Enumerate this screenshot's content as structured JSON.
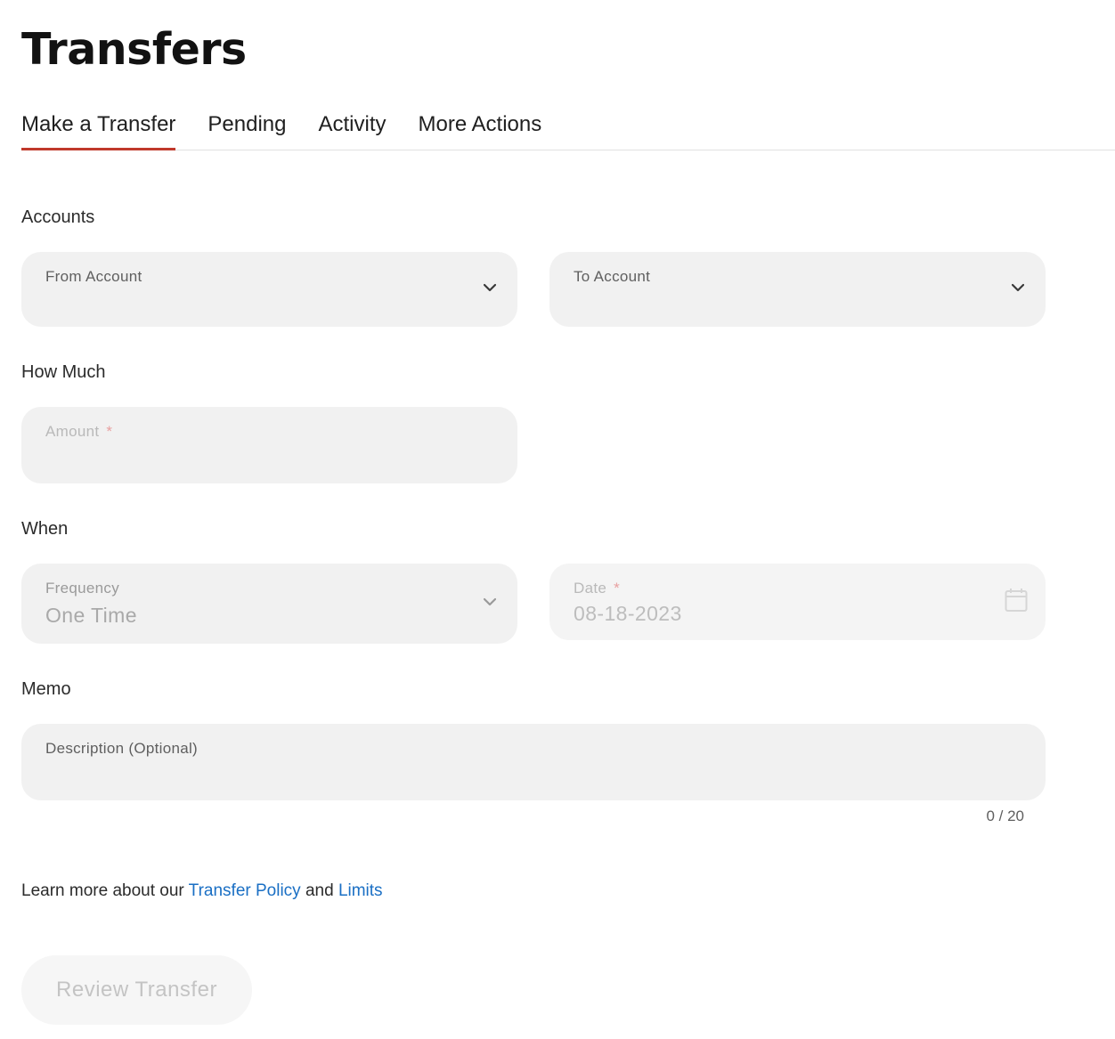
{
  "page": {
    "title": "Transfers"
  },
  "tabs": [
    {
      "label": "Make a Transfer",
      "active": true
    },
    {
      "label": "Pending",
      "active": false
    },
    {
      "label": "Activity",
      "active": false
    },
    {
      "label": "More Actions",
      "active": false
    }
  ],
  "sections": {
    "accounts": "Accounts",
    "how_much": "How Much",
    "when": "When",
    "memo": "Memo"
  },
  "fields": {
    "from_account": {
      "label": "From Account",
      "value": ""
    },
    "to_account": {
      "label": "To Account",
      "value": ""
    },
    "amount": {
      "label": "Amount",
      "required_mark": "*",
      "value": ""
    },
    "frequency": {
      "label": "Frequency",
      "value": "One Time"
    },
    "date": {
      "label": "Date",
      "required_mark": "*",
      "value": "08-18-2023"
    },
    "description": {
      "label": "Description (Optional)",
      "value": ""
    }
  },
  "memo_counter": "0 / 20",
  "learn_more": {
    "prefix": "Learn more about our ",
    "policy_link": "Transfer Policy",
    "middle": " and ",
    "limits_link": "Limits"
  },
  "actions": {
    "review_label": "Review Transfer"
  },
  "colors": {
    "accent_tab_underline": "#c0392b",
    "link": "#1a6fc4",
    "field_bg": "#f1f1f1"
  },
  "icons": {
    "dropdown": "chevron-down-icon",
    "date_picker": "calendar-icon"
  }
}
